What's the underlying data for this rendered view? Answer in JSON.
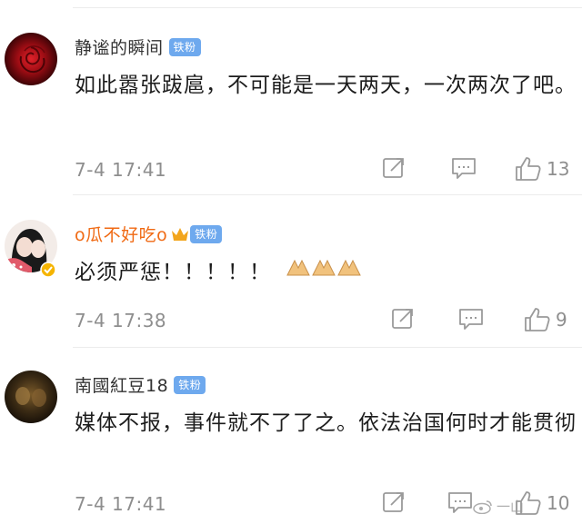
{
  "comments": [
    {
      "username": "静谧的瞬间",
      "badge": "铁粉",
      "text": "如此嚣张跋扈，不可能是一天两天，一次两次了吧。",
      "time": "7-4 17:41",
      "likes": "13",
      "avatar": "red-rose-avatar"
    },
    {
      "username": "o瓜不好吃o",
      "badge": "铁粉",
      "text": "必须严惩！！！！！",
      "emoji_count": 3,
      "time": "7-4 17:38",
      "likes": "9",
      "avatar": "illustrated-couple-avatar"
    },
    {
      "username": "南國紅豆18",
      "badge": "铁粉",
      "text": "媒体不报，事件就不了了之。依法治国何时才能贯彻",
      "time": "7-4 17:41",
      "likes": "10",
      "avatar": "dark-portrait-avatar"
    }
  ],
  "icons": {
    "share": "share-icon",
    "comment": "comment-icon",
    "like": "thumbs-up-icon",
    "pray": "praying-hands-icon",
    "crown": "crown-icon"
  },
  "colors": {
    "badge": "#6ea9ee",
    "vip_name": "#f06a14",
    "icon_gray": "#9a9a9a",
    "time_gray": "#8e8e8e"
  },
  "watermark": {
    "text": "一山"
  }
}
